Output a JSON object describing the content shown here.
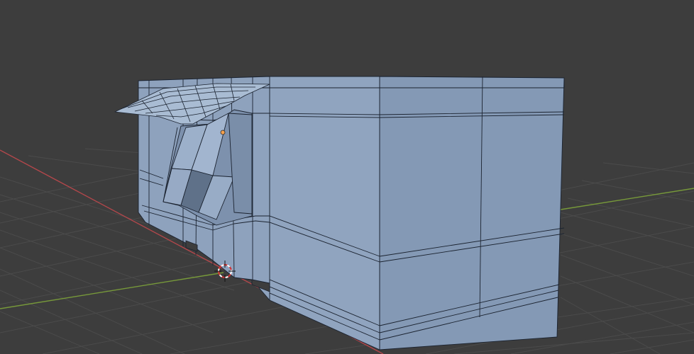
{
  "viewport": {
    "mode": "3D Viewport",
    "background_color": "#3d3d3d",
    "grid_color": "#4a4a4a",
    "x_axis_color": "#b3474b",
    "y_axis_color": "#77993a",
    "mesh_color": "#8aa0bd",
    "wire_color": "#1b2330"
  },
  "scene": {
    "objects": [
      {
        "name": "building-mesh",
        "type": "mesh"
      },
      {
        "name": "awning-mesh",
        "type": "mesh"
      }
    ],
    "gizmos": [
      {
        "name": "3d-cursor-icon"
      },
      {
        "name": "object-origin-icon"
      }
    ]
  }
}
